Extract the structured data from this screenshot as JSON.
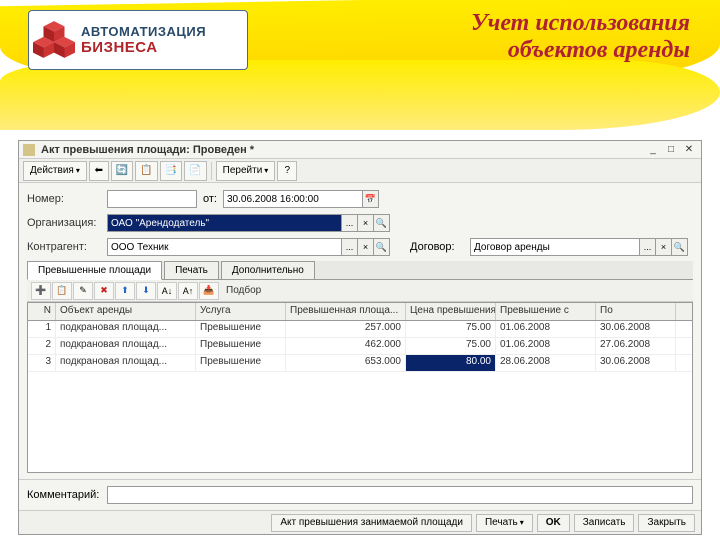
{
  "banner": {
    "logo_line1": "АВТОМАТИЗАЦИЯ",
    "logo_line2": "БИЗНЕСА",
    "title_line1": "Учет использования",
    "title_line2": "объектов аренды"
  },
  "window": {
    "title": "Акт превышения площади: Проведен *",
    "toolbar": {
      "actions": "Действия",
      "goto": "Перейти",
      "help": "?"
    },
    "form": {
      "number_label": "Номер:",
      "number_value": "",
      "date_label": "от:",
      "date_value": "30.06.2008 16:00:00",
      "org_label": "Организация:",
      "org_value": "ОАО \"Арендодатель\"",
      "contragent_label": "Контрагент:",
      "contragent_value": "ООО Техник",
      "contract_label": "Договор:",
      "contract_value": "Договор аренды"
    },
    "tabs": {
      "tab1": "Превышенные площади",
      "tab2": "Печать",
      "tab3": "Дополнительно"
    },
    "grid_toolbar": {
      "selection": "Подбор"
    },
    "grid": {
      "headers": {
        "n": "N",
        "object": "Объект аренды",
        "service": "Услуга",
        "area": "Превышенная площа...",
        "price": "Цена превышения",
        "from": "Превышение с",
        "to": "По"
      },
      "rows": [
        {
          "n": "1",
          "object": "подкрановая площад...",
          "service": "Превышение",
          "area": "257.000",
          "price": "75.00",
          "from": "01.06.2008",
          "to": "30.06.2008"
        },
        {
          "n": "2",
          "object": "подкрановая площад...",
          "service": "Превышение",
          "area": "462.000",
          "price": "75.00",
          "from": "01.06.2008",
          "to": "27.06.2008"
        },
        {
          "n": "3",
          "object": "подкрановая площад...",
          "service": "Превышение",
          "area": "653.000",
          "price": "80.00",
          "from": "28.06.2008",
          "to": "30.06.2008"
        }
      ]
    },
    "comment_label": "Комментарий:",
    "footer": {
      "doc": "Акт превышения занимаемой площади",
      "print": "Печать",
      "ok": "OK",
      "save": "Записать",
      "close": "Закрыть"
    }
  }
}
